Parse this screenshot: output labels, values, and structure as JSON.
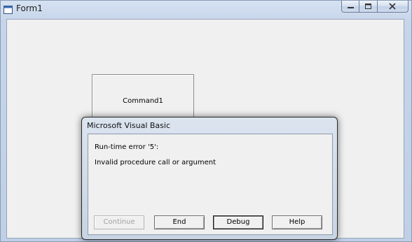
{
  "window": {
    "title": "Form1",
    "icon": "form-icon",
    "caption_buttons": [
      "minimize-icon",
      "maximize-icon",
      "close-icon"
    ]
  },
  "form": {
    "command1_label": "Command1"
  },
  "dialog": {
    "title": "Microsoft Visual Basic",
    "error_line": "Run-time error '5':",
    "message": "Invalid procedure call or argument",
    "buttons": {
      "continue": "Continue",
      "end": "End",
      "debug": "Debug",
      "help": "Help"
    },
    "disabled_button": "Continue",
    "default_button": "Debug"
  },
  "colors": {
    "titlebar": "#c6d5ea",
    "client_background": "#f0f0f0",
    "disabled_text": "#a0a0a0"
  }
}
